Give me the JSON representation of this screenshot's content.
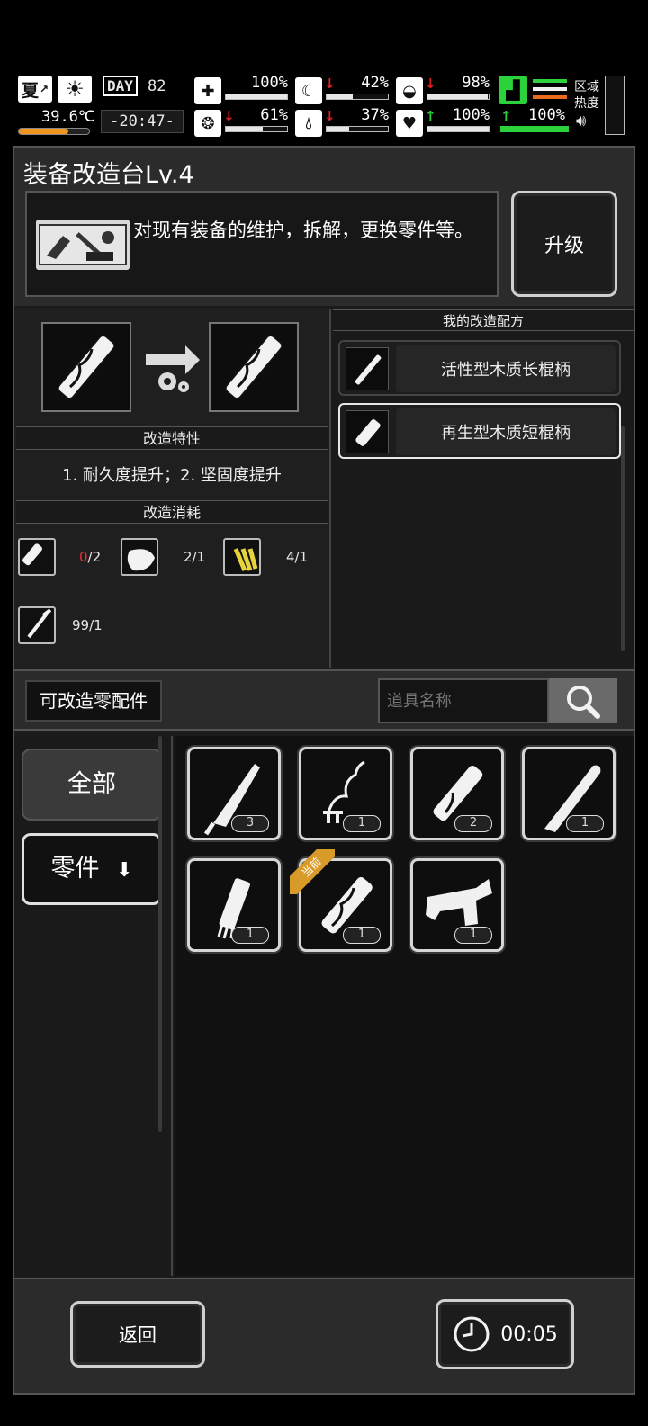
{
  "status": {
    "season": "夏",
    "temperature": "39.6℃",
    "day_label": "DAY",
    "day": "82",
    "time": "-20:47-",
    "stats": [
      {
        "key": "health",
        "value": "100%",
        "level": 1.0,
        "trend": ""
      },
      {
        "key": "hunger",
        "value": "42%",
        "level": 0.42,
        "trend": "down"
      },
      {
        "key": "armor",
        "value": "98%",
        "level": 0.98,
        "trend": "down"
      },
      {
        "key": "mood",
        "value": "61%",
        "level": 0.61,
        "trend": "down"
      },
      {
        "key": "water",
        "value": "37%",
        "level": 0.37,
        "trend": "down"
      },
      {
        "key": "heart",
        "value": "100%",
        "level": 1.0,
        "trend": "up"
      },
      {
        "key": "stamina",
        "value": "100%",
        "level": 1.0,
        "trend": "up"
      }
    ],
    "zone_heat_label": "区域热度",
    "colors": {
      "stamina": "#2cd23a",
      "down": "#e02020",
      "up": "#2cd23a",
      "temp_bar": "#f0961e"
    }
  },
  "station": {
    "title": "装备改造台Lv.4",
    "description": "对现有装备的维护，拆解，更换零件等。",
    "upgrade_label": "升级"
  },
  "modify": {
    "traits_header": "改造特性",
    "traits_text": "1. 耐久度提升；2. 坚固度提升",
    "cost_header": "改造消耗",
    "costs": [
      {
        "icon": "flashlight-part-icon",
        "have": "0",
        "need": "/2",
        "insufficient": true
      },
      {
        "icon": "wood-plank-icon",
        "text": "2/1"
      },
      {
        "icon": "yellow-fiber-icon",
        "text": "4/1"
      },
      {
        "icon": "syringe-tool-icon",
        "text": "99/1"
      }
    ]
  },
  "recipes": {
    "header": "我的改造配方",
    "items": [
      {
        "name": "活性型木质长棍柄",
        "selected": false
      },
      {
        "name": "再生型木质短棍柄",
        "selected": true
      }
    ]
  },
  "parts": {
    "tab_label": "可改造零配件",
    "search_placeholder": "道具名称",
    "categories": [
      {
        "label": "全部"
      },
      {
        "label": "零件"
      }
    ],
    "current_badge": "当前",
    "items": [
      {
        "icon": "blade-icon",
        "count": "3"
      },
      {
        "icon": "wire-icon",
        "count": "1"
      },
      {
        "icon": "wood-handle-icon",
        "count": "2"
      },
      {
        "icon": "machete-icon",
        "count": "1"
      },
      {
        "icon": "grip-handle-icon",
        "count": "1"
      },
      {
        "icon": "wood-short-handle-icon",
        "count": "1",
        "current": true
      },
      {
        "icon": "trigger-mechanism-icon",
        "count": "1"
      }
    ]
  },
  "footer": {
    "back_label": "返回",
    "timer": "00:05"
  }
}
